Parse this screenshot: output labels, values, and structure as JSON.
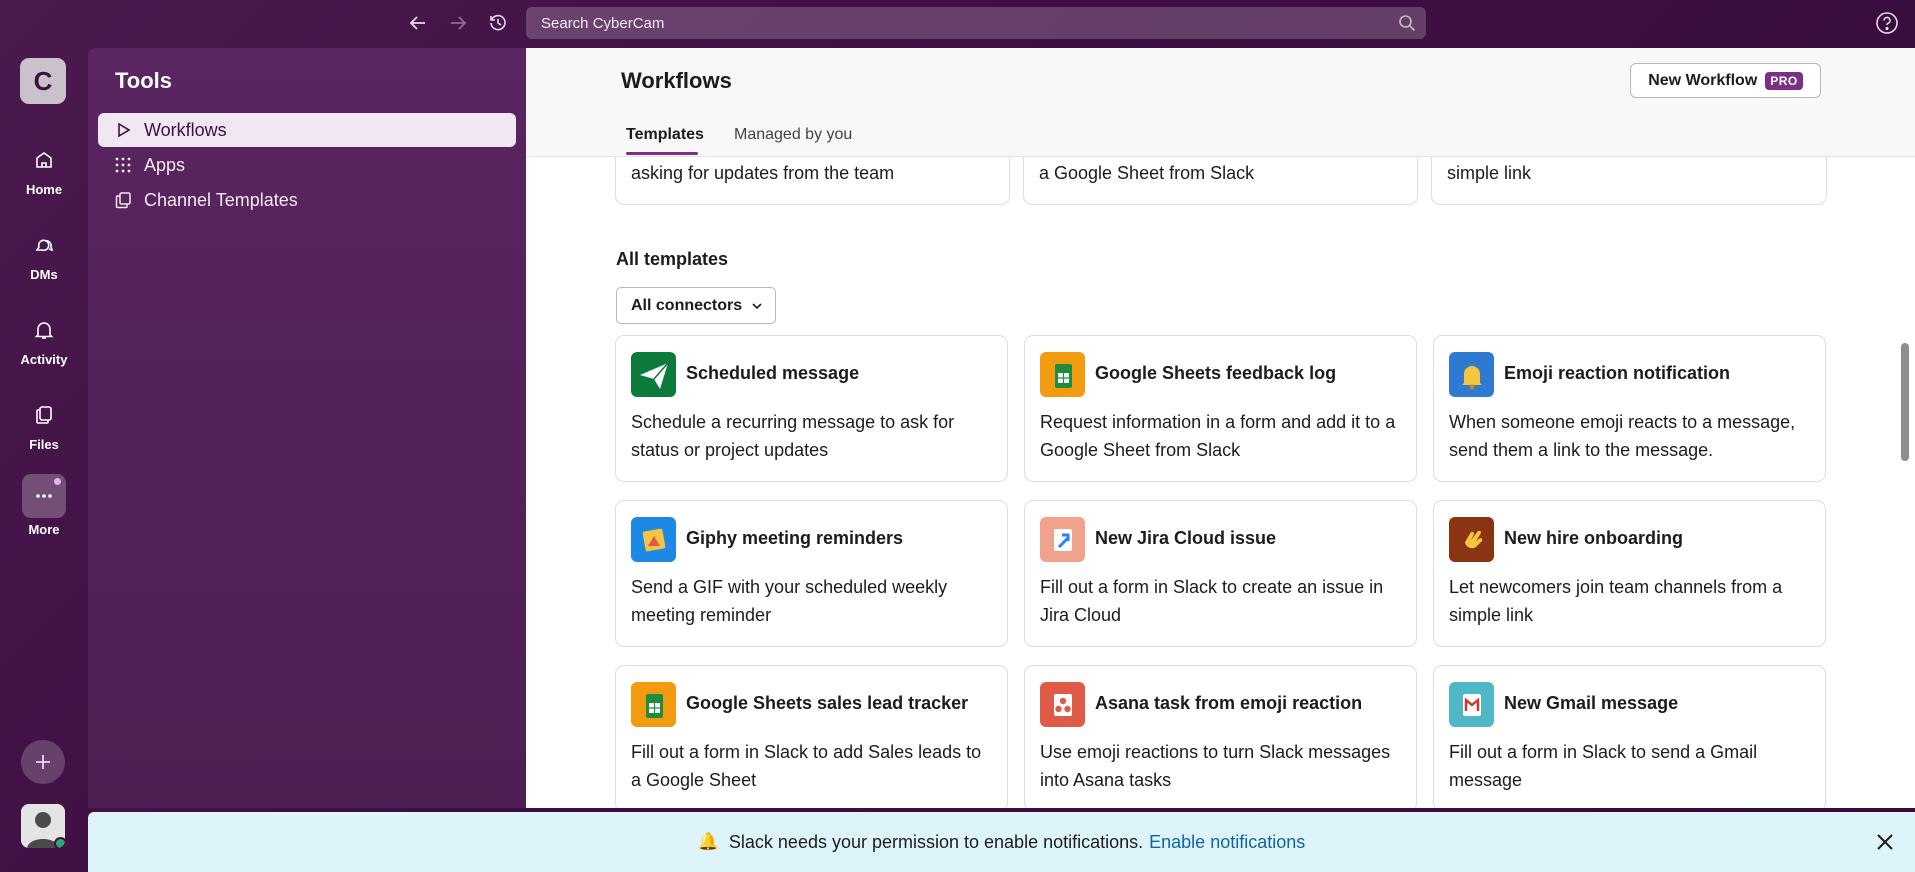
{
  "app": {
    "workspace_initial": "C"
  },
  "search": {
    "placeholder": "Search CyberCam"
  },
  "rail": {
    "items": [
      {
        "label": "Home",
        "icon": "home-icon"
      },
      {
        "label": "DMs",
        "icon": "dm-icon"
      },
      {
        "label": "Activity",
        "icon": "bell-icon"
      },
      {
        "label": "Files",
        "icon": "files-icon"
      },
      {
        "label": "More",
        "icon": "more-icon"
      }
    ]
  },
  "sidebar": {
    "title": "Tools",
    "items": [
      {
        "label": "Workflows",
        "icon": "play-icon",
        "active": true
      },
      {
        "label": "Apps",
        "icon": "grid-icon",
        "active": false
      },
      {
        "label": "Channel Templates",
        "icon": "copy-icon",
        "active": false
      }
    ]
  },
  "main": {
    "title": "Workflows",
    "new_workflow_label": "New Workflow",
    "pro_badge": "PRO",
    "tabs": [
      {
        "label": "Templates",
        "active": true
      },
      {
        "label": "Managed by you",
        "active": false
      }
    ],
    "cut_cards": [
      {
        "desc": "asking for updates from the team"
      },
      {
        "desc": "a Google Sheet from Slack"
      },
      {
        "desc": "simple link"
      }
    ],
    "section_title": "All templates",
    "filter_label": "All connectors",
    "cards": [
      {
        "title": "Scheduled message",
        "desc": "Schedule a recurring message to ask for status or project updates",
        "icon": "paper-plane-icon",
        "color": "#0b7a3b"
      },
      {
        "title": "Google Sheets feedback log",
        "desc": "Request information in a form and add it to a Google Sheet from Slack",
        "icon": "sheets-icon",
        "color": "#f29b11"
      },
      {
        "title": "Emoji reaction notification",
        "desc": "When someone emoji reacts to a message, send them a link to the message.",
        "icon": "bell-emoji-icon",
        "color": "#2e7ad1"
      },
      {
        "title": "Giphy meeting reminders",
        "desc": "Send a GIF with your scheduled weekly meeting reminder",
        "icon": "giphy-icon",
        "color": "#1e88e5"
      },
      {
        "title": "New Jira Cloud issue",
        "desc": "Fill out a form in Slack to create an issue in Jira Cloud",
        "icon": "jira-icon",
        "color": "#f0a28c"
      },
      {
        "title": "New hire onboarding",
        "desc": "Let newcomers join team channels from a simple link",
        "icon": "wave-icon",
        "color": "#8a3412"
      },
      {
        "title": "Google Sheets sales lead tracker",
        "desc": "Fill out a form in Slack to add Sales leads to a Google Sheet",
        "icon": "sheets-icon",
        "color": "#f29b11"
      },
      {
        "title": "Asana task from emoji reaction",
        "desc": "Use emoji reactions to turn Slack messages into Asana tasks",
        "icon": "asana-icon",
        "color": "#e05a48"
      },
      {
        "title": "New Gmail message",
        "desc": "Fill out a form in Slack to send a Gmail message",
        "icon": "gmail-icon",
        "color": "#4fb7c8"
      }
    ]
  },
  "banner": {
    "icon": "🔔",
    "text": "Slack needs your permission to enable notifications.",
    "link": "Enable notifications"
  }
}
